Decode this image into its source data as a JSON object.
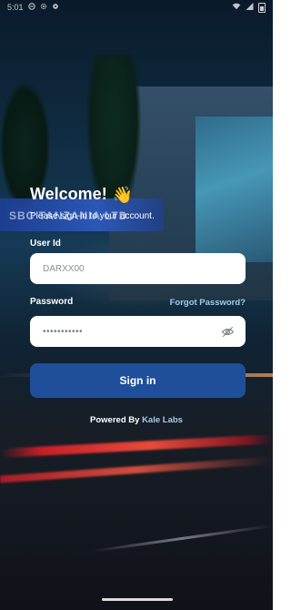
{
  "status_bar": {
    "time": "5:01",
    "left_icons": [
      "dnd-icon",
      "gear-icon",
      "settings-icon"
    ],
    "right_icons": [
      "wifi-icon",
      "signal-icon",
      "battery-icon"
    ]
  },
  "background": {
    "sign_text": "SBC TANZANIA LTD"
  },
  "login": {
    "title": "Welcome!",
    "title_emoji": "👋",
    "subtitle": "Please sign-in to your account.",
    "user_id_label": "User Id",
    "user_id_placeholder": "DARXX00",
    "user_id_value": "",
    "password_label": "Password",
    "forgot_password": "Forgot Password?",
    "password_value": "•••••••••••",
    "signin_button": "Sign in"
  },
  "footer": {
    "powered_prefix": "Powered By ",
    "powered_brand": "Kale Labs"
  },
  "colors": {
    "button": "#1f4f9a",
    "link": "#9fd0e8"
  }
}
